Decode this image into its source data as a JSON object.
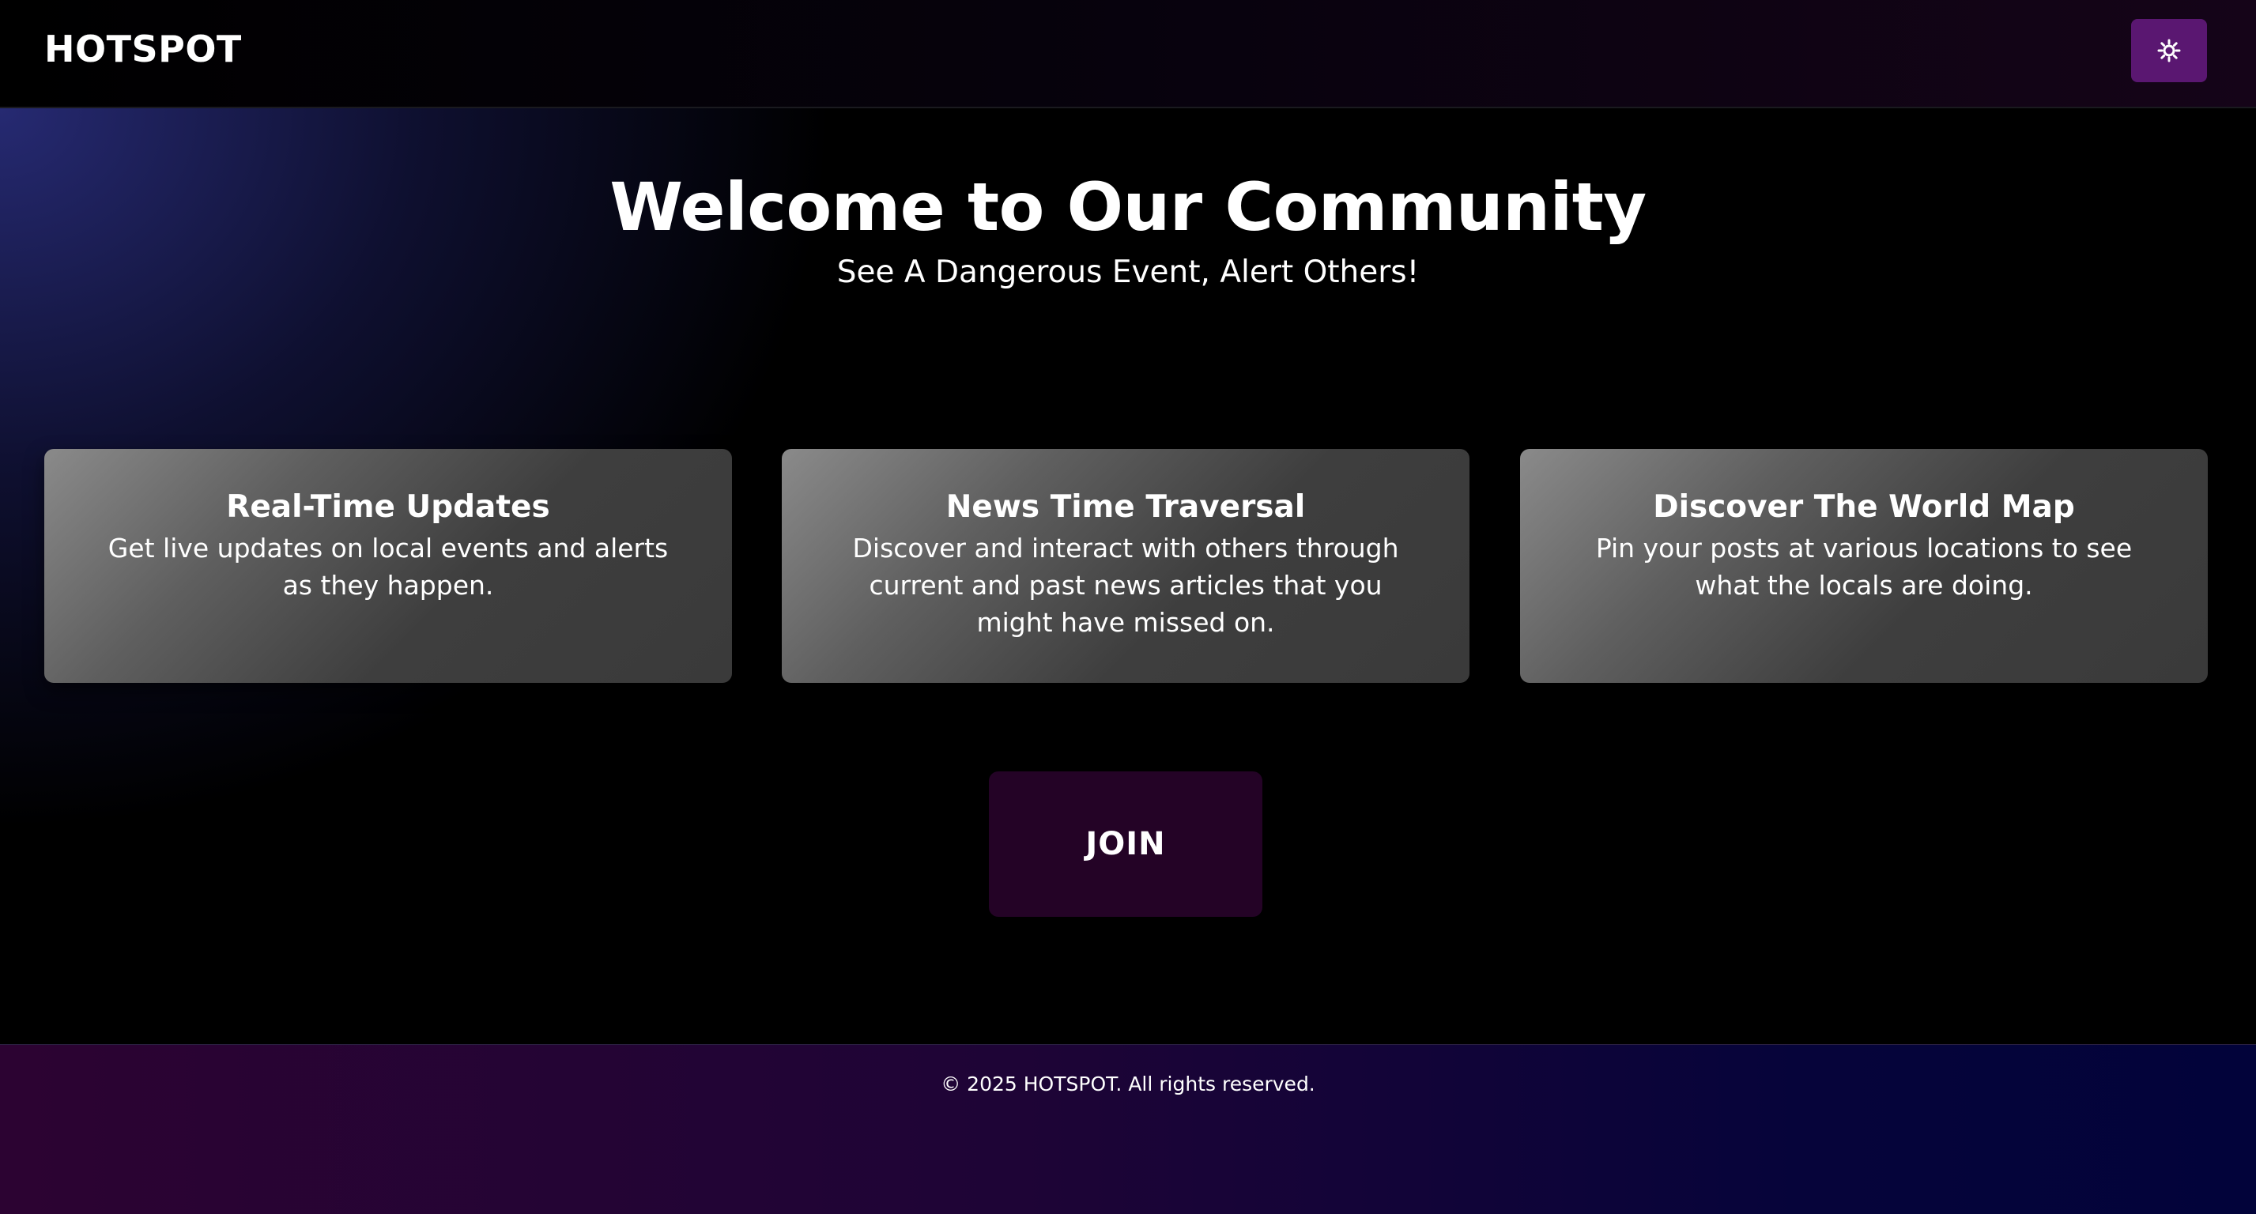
{
  "header": {
    "brand": "HOTSPOT",
    "theme_toggle_icon": "sun-icon",
    "theme_toggle_color": "#5a1771"
  },
  "hero": {
    "title": "Welcome to Our Community",
    "subtitle": "See A Dangerous Event, Alert Others!"
  },
  "features": [
    {
      "title": "Real-Time Updates",
      "description": "Get live updates on local events and alerts as they happen."
    },
    {
      "title": "News Time Traversal",
      "description": "Discover and interact with others through current and past news articles that you might have missed on."
    },
    {
      "title": "Discover The World Map",
      "description": "Pin your posts at various locations to see what the locals are doing."
    }
  ],
  "join_button": {
    "label": "JOIN",
    "color": "#240326"
  },
  "footer": {
    "copyright": "© 2025 HOTSPOT. All rights reserved."
  }
}
